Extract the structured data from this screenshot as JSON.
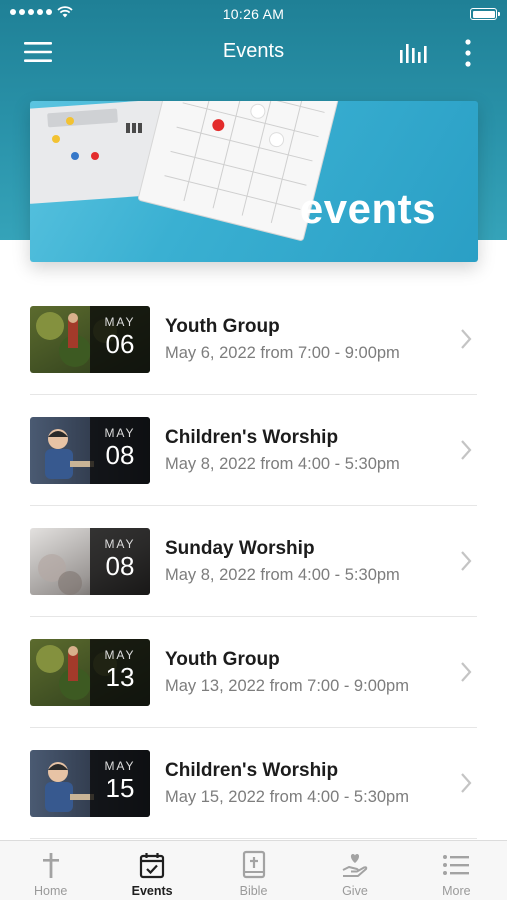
{
  "status_bar": {
    "time": "10:26 AM"
  },
  "header": {
    "title": "Events"
  },
  "banner": {
    "text": "events"
  },
  "events": [
    {
      "title": "Youth Group",
      "month": "MAY",
      "day": "06",
      "subtitle": "May 6, 2022 from 7:00 - 9:00pm",
      "thumb": "forest"
    },
    {
      "title": "Children's Worship",
      "month": "MAY",
      "day": "08",
      "subtitle": "May 8, 2022 from 4:00 - 5:30pm",
      "thumb": "child"
    },
    {
      "title": "Sunday Worship",
      "month": "MAY",
      "day": "08",
      "subtitle": "May 8, 2022 from 4:00 - 5:30pm",
      "thumb": "haze"
    },
    {
      "title": "Youth Group",
      "month": "MAY",
      "day": "13",
      "subtitle": "May 13, 2022 from 7:00 - 9:00pm",
      "thumb": "forest"
    },
    {
      "title": "Children's Worship",
      "month": "MAY",
      "day": "15",
      "subtitle": "May 15, 2022 from 4:00 - 5:30pm",
      "thumb": "child"
    }
  ],
  "tabs": [
    {
      "label": "Home",
      "icon": "cross-icon"
    },
    {
      "label": "Events",
      "icon": "calendar-icon",
      "active": true
    },
    {
      "label": "Bible",
      "icon": "bible-icon"
    },
    {
      "label": "Give",
      "icon": "give-hand-icon"
    },
    {
      "label": "More",
      "icon": "list-icon"
    }
  ],
  "colors": {
    "header_teal": "#1f8096",
    "banner_blue": "#3ab0d2",
    "active_tab": "#1f1f1f",
    "inactive_tab": "#9a9a9a"
  }
}
